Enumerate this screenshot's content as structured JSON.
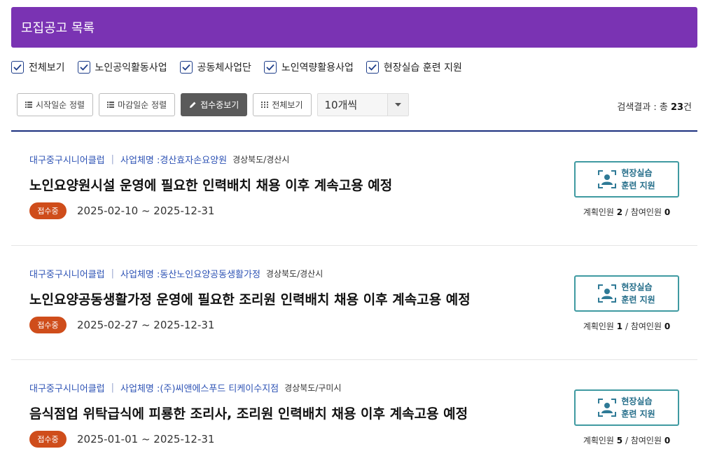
{
  "header": {
    "title": "모집공고 목록"
  },
  "filters": [
    {
      "label": "전체보기",
      "checked": true
    },
    {
      "label": "노인공익활동사업",
      "checked": true
    },
    {
      "label": "공동체사업단",
      "checked": true
    },
    {
      "label": "노인역량활용사업",
      "checked": true
    },
    {
      "label": "현장실습 훈련 지원",
      "checked": true
    }
  ],
  "toolbar": {
    "sort_start_label": "시작일순 정렬",
    "sort_deadline_label": "마감일순 정렬",
    "accepting_label": "접수중보기",
    "view_all_label": "전체보기",
    "page_size_value": "10개씩"
  },
  "result": {
    "prefix": "검색결과 : 총 ",
    "count": "23",
    "suffix": "건"
  },
  "posts": [
    {
      "club": "대구중구시니어클럽",
      "biz_label": "사업체명 : ",
      "biz_name": "경산효자손요양원",
      "region": "경상북도/경산시",
      "title": "노인요양원시설 운영에 필요한 인력배치 채용 이후 계속고용 예정",
      "status": "접수중",
      "period": "2025-02-10 ~ 2025-12-31",
      "badge_line1": "현장실습",
      "badge_line2": "훈련 지원",
      "plan_label": "계획인원 ",
      "plan_count": "2",
      "join_label": " / 참여인원 ",
      "join_count": "0"
    },
    {
      "club": "대구중구시니어클럽",
      "biz_label": "사업체명 : ",
      "biz_name": "동산노인요양공동생활가정",
      "region": "경상북도/경산시",
      "title": "노인요양공동생활가정 운영에 필요한 조리원 인력배치 채용 이후 계속고용 예정",
      "status": "접수중",
      "period": "2025-02-27 ~ 2025-12-31",
      "badge_line1": "현장실습",
      "badge_line2": "훈련 지원",
      "plan_label": "계획인원 ",
      "plan_count": "1",
      "join_label": " / 참여인원 ",
      "join_count": "0"
    },
    {
      "club": "대구중구시니어클럽",
      "biz_label": "사업체명 : ",
      "biz_name": "(주)씨앤에스푸드 티케이수지점",
      "region": "경상북도/구미시",
      "title": "음식점업 위탁급식에 피룡한 조리사, 조리원 인력배치 채용 이후 계속고용 예정",
      "status": "접수중",
      "period": "2025-01-01 ~ 2025-12-31",
      "badge_line1": "현장실습",
      "badge_line2": "훈련 지원",
      "plan_label": "계획인원 ",
      "plan_count": "5",
      "join_label": " / 참여인원 ",
      "join_count": "0"
    }
  ]
}
